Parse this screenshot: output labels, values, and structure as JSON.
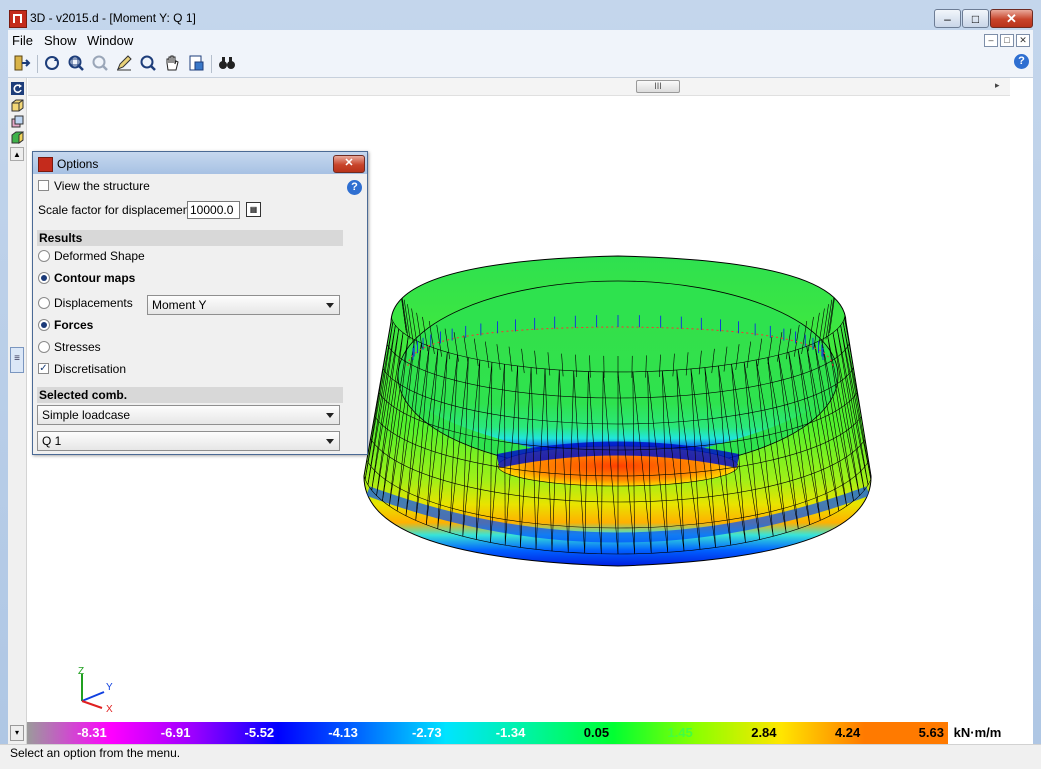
{
  "window": {
    "title": "3D - v2015.d - [Moment Y: Q 1]",
    "close_glyph": "✕",
    "minimize_glyph": "–",
    "maximize_glyph": "□"
  },
  "menu": {
    "items": [
      "File",
      "Show",
      "Window"
    ]
  },
  "toolbar": {
    "icons": [
      "exit-icon",
      "rotate-icon",
      "zoom-window-icon",
      "zoom-previous-icon",
      "pencil-icon",
      "zoom-icon",
      "pan-hand-icon",
      "print-icon",
      "find-binoculars-icon"
    ],
    "help": "?"
  },
  "scrollbar": {
    "thumb_glyph": "III",
    "right_arrow": "▸"
  },
  "side_panel": {
    "handle_glyph": "≡",
    "bottom_glyph": "▾"
  },
  "options_dialog": {
    "title": "Options",
    "close": "✕",
    "help": "?",
    "view_structure": {
      "label": "View the structure",
      "checked": false
    },
    "scale_label": "Scale factor for displacements",
    "scale_value": "10000.0",
    "results_heading": "Results",
    "deformed_shape": "Deformed Shape",
    "contour_maps": "Contour maps",
    "displacements": "Displacements",
    "forces": "Forces",
    "stresses": "Stresses",
    "discretisation": "Discretisation",
    "quantity_select": "Moment Y",
    "selected_comb_heading": "Selected comb.",
    "comb_type_select": "Simple loadcase",
    "comb_select": "Q 1",
    "check_mark": "✓"
  },
  "axes": {
    "x": "X",
    "y": "Y",
    "z": "Z"
  },
  "legend": {
    "values": [
      "-8.31",
      "-6.91",
      "-5.52",
      "-4.13",
      "-2.73",
      "-1.34",
      "0.05",
      "1.45",
      "2.84",
      "4.24",
      "5.63"
    ],
    "unit": "kN·m/m",
    "colors": [
      "#9b9b9b",
      "#ff00ff",
      "#9a00ff",
      "#0000ff",
      "#006bff",
      "#00e4ff",
      "#00f4a0",
      "#00ff32",
      "#8cff00",
      "#ffe600",
      "#ff7a00"
    ],
    "text_colors": [
      "#ffffff",
      "#ffffff",
      "#ffffff",
      "#ffffff",
      "#ffffff",
      "#ffffff",
      "#000000",
      "#41ff41",
      "#000000",
      "#000000",
      "#000000"
    ]
  },
  "status": {
    "text": "Select an option from the menu."
  }
}
